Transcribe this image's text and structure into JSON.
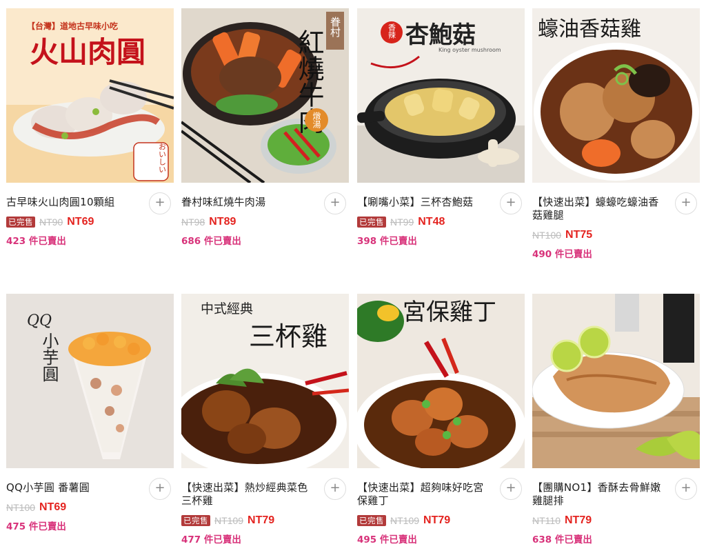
{
  "products": [
    {
      "image_overlay": "【台灣】道地古早味小吃",
      "image_title": "火山肉圓",
      "image_side": "おいしい",
      "name": "古早味火山肉圓10顆組",
      "sold_badge": "已完售",
      "orig_price": "NT90",
      "price": "NT69",
      "sold_count": "423",
      "sold_unit": " 件已賣出",
      "add_label": "+"
    },
    {
      "image_overlay": "眷村",
      "image_title": "紅燒牛肉",
      "image_side": "燉湯",
      "name": "眷村味紅燒牛肉湯",
      "sold_badge": "",
      "orig_price": "NT98",
      "price": "NT89",
      "sold_count": "686",
      "sold_unit": " 件已賣出",
      "add_label": "+"
    },
    {
      "image_overlay": "香辣",
      "image_title": "杏鮑菇",
      "image_side": "King oyster mushroom",
      "name": "【唰嘴小菜】三杯杏鮑菇",
      "sold_badge": "已完售",
      "orig_price": "NT99",
      "price": "NT48",
      "sold_count": "398",
      "sold_unit": " 件已賣出",
      "add_label": "+"
    },
    {
      "image_overlay": "",
      "image_title": "蠔油香菇雞",
      "image_side": "",
      "name": "【快速出菜】蠔蠔吃蠔油香菇雞腿",
      "sold_badge": "",
      "orig_price": "NT100",
      "price": "NT75",
      "sold_count": "490",
      "sold_unit": " 件已賣出",
      "add_label": "+"
    },
    {
      "image_overlay": "QQ",
      "image_title": "小芋圓",
      "image_side": "",
      "name": "QQ小芋圓 番薯圓",
      "sold_badge": "",
      "orig_price": "NT100",
      "price": "NT69",
      "sold_count": "475",
      "sold_unit": " 件已賣出",
      "add_label": "+"
    },
    {
      "image_overlay": "中式經典",
      "image_title": "三杯雞",
      "image_side": "",
      "name": "【快速出菜】熱炒經典菜色三杯雞",
      "sold_badge": "已完售",
      "orig_price": "NT109",
      "price": "NT79",
      "sold_count": "477",
      "sold_unit": " 件已賣出",
      "add_label": "+"
    },
    {
      "image_overlay": "",
      "image_title": "宮保雞丁",
      "image_side": "",
      "name": "【快速出菜】超夠味好吃宮保雞丁",
      "sold_badge": "已完售",
      "orig_price": "NT109",
      "price": "NT79",
      "sold_count": "495",
      "sold_unit": " 件已賣出",
      "add_label": "+"
    },
    {
      "image_overlay": "",
      "image_title": "",
      "image_side": "",
      "name": "【團購NO1】香酥去骨鮮嫩雞腿排",
      "sold_badge": "",
      "orig_price": "NT110",
      "price": "NT79",
      "sold_count": "638",
      "sold_unit": " 件已賣出",
      "add_label": "+"
    }
  ],
  "colors": {
    "badge": "#b23a3a",
    "price": "#e4231f",
    "sold_count": "#d8327a",
    "strike": "#bbbbbb"
  }
}
